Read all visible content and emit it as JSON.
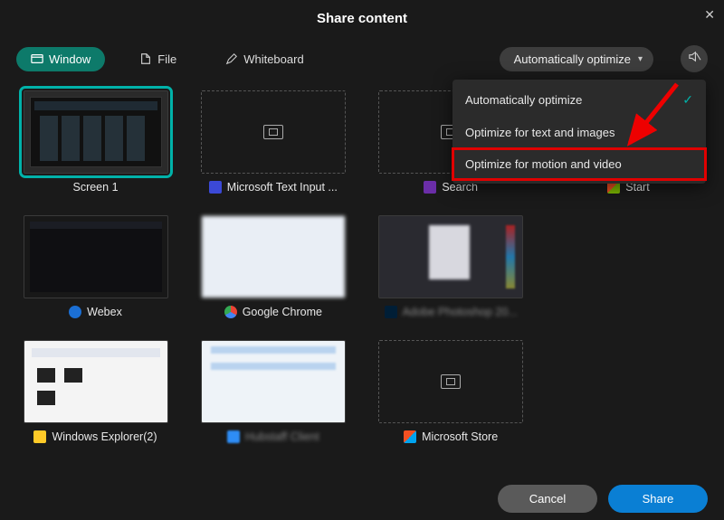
{
  "title": "Share content",
  "tabs": {
    "window": "Window",
    "file": "File",
    "whiteboard": "Whiteboard"
  },
  "optimize": {
    "button_label": "Automatically optimize",
    "menu": {
      "auto": "Automatically optimize",
      "text": "Optimize for text and images",
      "motion": "Optimize for motion and video"
    }
  },
  "tiles": {
    "screen1": "Screen 1",
    "msinput": "Microsoft Text Input ...",
    "search": "Search",
    "start": "Start",
    "webex": "Webex",
    "chrome": "Google Chrome",
    "photoshop": "Adobe Photoshop 20...",
    "explorer": "Windows Explorer(2)",
    "hubstaff": "Hubstaff Client",
    "msstore": "Microsoft Store"
  },
  "buttons": {
    "cancel": "Cancel",
    "share": "Share"
  },
  "colors": {
    "accent_teal": "#00b2a9",
    "accent_blue": "#0a7fd4",
    "highlight_red": "#e00000"
  }
}
